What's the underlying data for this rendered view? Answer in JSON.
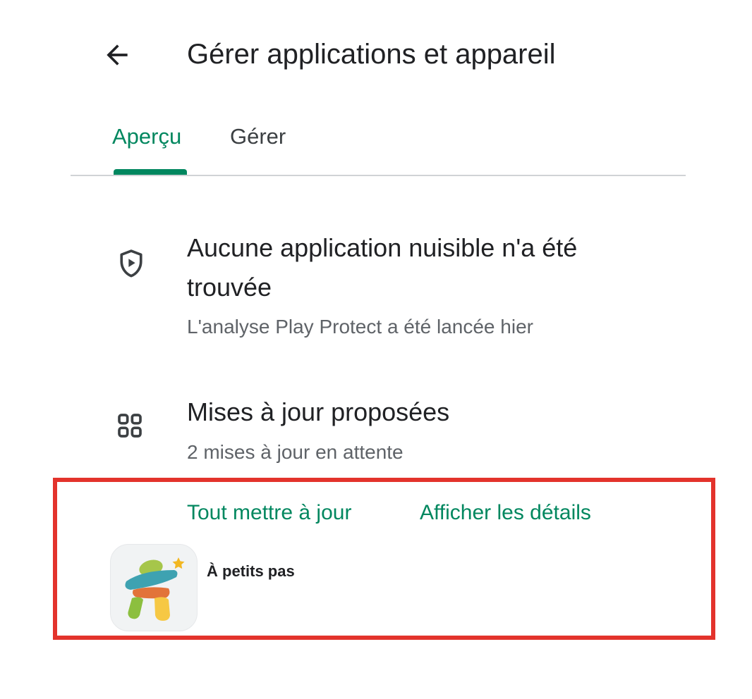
{
  "header": {
    "back_icon": "arrow-back-icon",
    "title": "Gérer applications et appareil"
  },
  "tabs": [
    {
      "label": "Aperçu",
      "active": true
    },
    {
      "label": "Gérer",
      "active": false
    }
  ],
  "colors": {
    "accent": "#01875f",
    "highlight_border": "#e3332c",
    "primary_text": "#202124",
    "secondary_text": "#5f6368"
  },
  "protect": {
    "icon": "shield-play-icon",
    "title_line1": "Aucune application nuisible n'a été",
    "title_line2": "trouvée",
    "subtitle": "L'analyse Play Protect a été lancée hier"
  },
  "updates": {
    "icon": "apps-grid-icon",
    "title": "Mises à jour proposées",
    "subtitle": "2 mises à jour en attente",
    "update_all_label": "Tout mettre à jour",
    "details_label": "Afficher les détails",
    "apps": [
      {
        "name": "À petits pas",
        "icon": "a-petits-pas-app-icon"
      }
    ]
  }
}
